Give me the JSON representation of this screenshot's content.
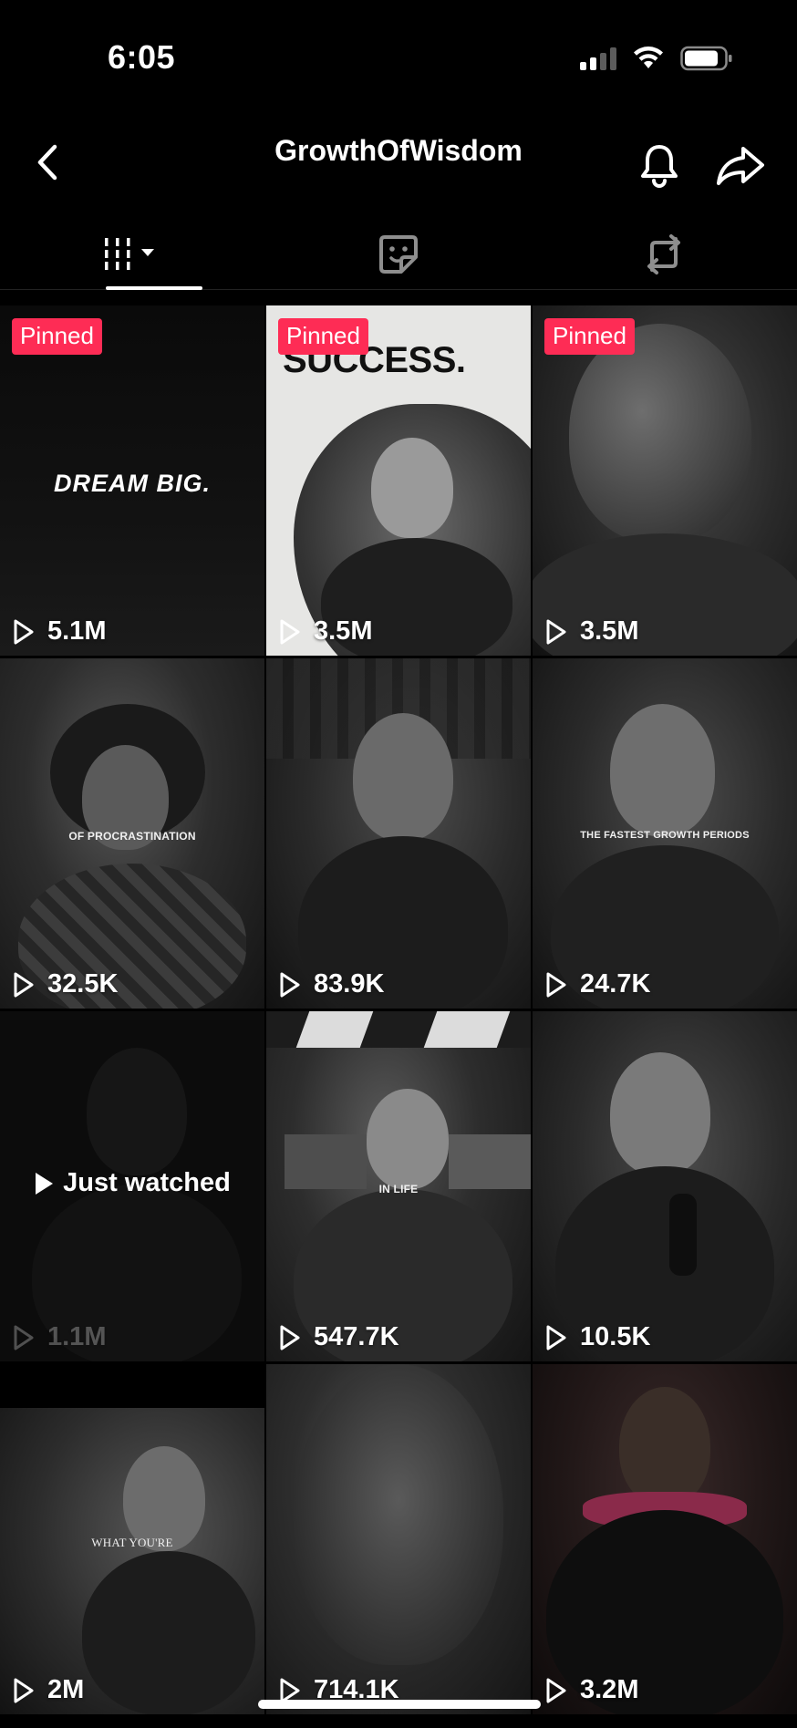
{
  "status_bar": {
    "time": "6:05"
  },
  "header": {
    "title": "GrowthOfWisdom"
  },
  "tabs": [
    {
      "name": "videos-grid-icon",
      "selected": true
    },
    {
      "name": "sticker-icon",
      "selected": false
    },
    {
      "name": "repost-icon",
      "selected": false
    }
  ],
  "videos": [
    {
      "views": "5.1M",
      "badge": "Pinned",
      "caption": "DREAM BIG."
    },
    {
      "views": "3.5M",
      "badge": "Pinned",
      "caption": "SUCCESS."
    },
    {
      "views": "3.5M",
      "badge": "Pinned",
      "caption": ""
    },
    {
      "views": "32.5K",
      "badge": "",
      "caption": "OF PROCRASTINATION"
    },
    {
      "views": "83.9K",
      "badge": "",
      "caption": ""
    },
    {
      "views": "24.7K",
      "badge": "",
      "caption": "THE FASTEST GROWTH PERIODS"
    },
    {
      "views": "1.1M",
      "badge": "",
      "caption": "",
      "overlay": "Just watched"
    },
    {
      "views": "547.7K",
      "badge": "",
      "caption": "IN LIFE"
    },
    {
      "views": "10.5K",
      "badge": "",
      "caption": ""
    },
    {
      "views": "2M",
      "badge": "",
      "caption": "WHAT YOU'RE"
    },
    {
      "views": "714.1K",
      "badge": "",
      "caption": ""
    },
    {
      "views": "3.2M",
      "badge": "",
      "caption": ""
    }
  ],
  "colors": {
    "pinned_badge": "#fe2c55",
    "background": "#000000"
  }
}
